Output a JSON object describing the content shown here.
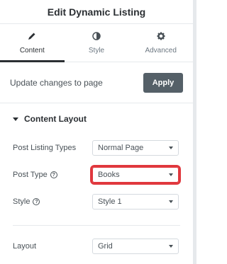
{
  "panel": {
    "title": "Edit Dynamic Listing"
  },
  "tabs": [
    {
      "label": "Content",
      "icon": "pencil-icon",
      "active": true
    },
    {
      "label": "Style",
      "icon": "half-circle-icon",
      "active": false
    },
    {
      "label": "Advanced",
      "icon": "gear-icon",
      "active": false
    }
  ],
  "update_bar": {
    "text": "Update changes to page",
    "apply_label": "Apply"
  },
  "section": {
    "title": "Content Layout"
  },
  "controls": {
    "post_listing_types": {
      "label": "Post Listing Types",
      "value": "Normal Page"
    },
    "post_type": {
      "label": "Post Type",
      "value": "Books"
    },
    "style": {
      "label": "Style",
      "value": "Style 1"
    },
    "layout": {
      "label": "Layout",
      "value": "Grid"
    }
  },
  "colors": {
    "highlight": "#e0383e",
    "apply_button": "#556068"
  }
}
